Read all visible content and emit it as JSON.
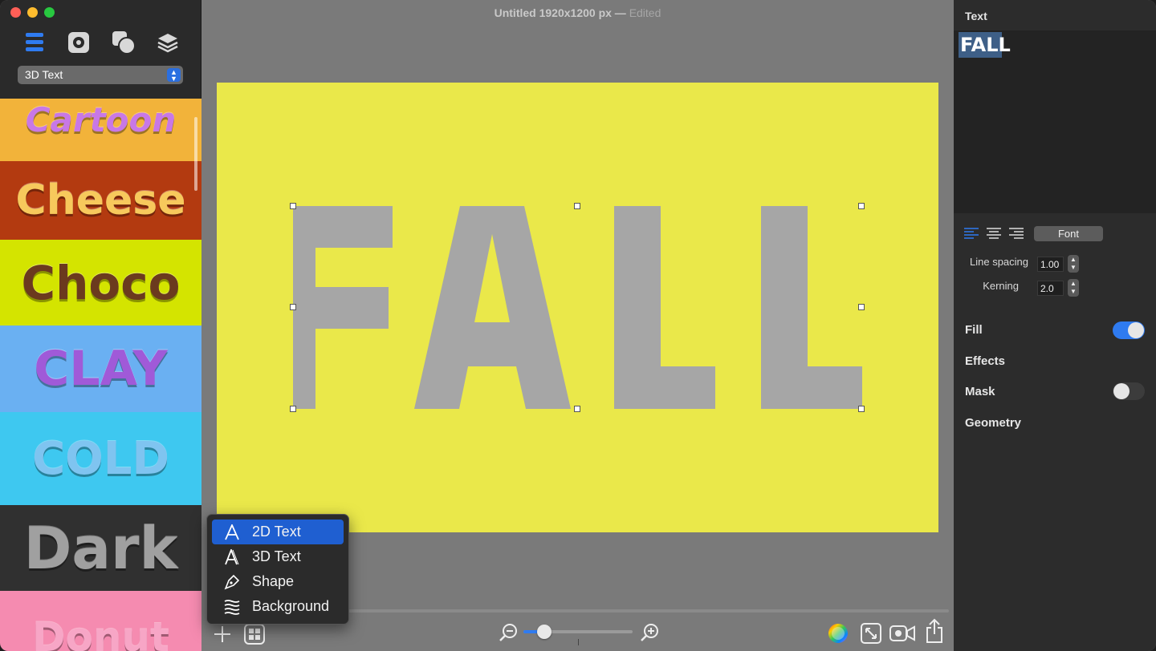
{
  "window": {
    "title": "Untitled 1920x1200 px",
    "title_sep": "—",
    "status": "Edited"
  },
  "sidebar": {
    "tool_icons": [
      "list-icon",
      "gear-icon",
      "shapes-icon",
      "layers-icon"
    ],
    "category_select": "3D Text",
    "presets": [
      {
        "label": "Cartoon",
        "bg": "#f2b33a",
        "color": "#c878e6"
      },
      {
        "label": "Cheese",
        "bg": "#b33a10",
        "color": "#f7c95c"
      },
      {
        "label": "Choco",
        "bg": "#d4e400",
        "color": "#6b3a1e"
      },
      {
        "label": "CLAY",
        "bg": "#6ab0f2",
        "color": "#a05ad8"
      },
      {
        "label": "COLD",
        "bg": "#3ec8f0",
        "color": "#7fc4f0"
      },
      {
        "label": "Dark",
        "bg": "#303030",
        "color": "#a0a0a0"
      },
      {
        "label": "Donut",
        "bg": "#f58bb0",
        "color": "#f7a6c6"
      }
    ]
  },
  "canvas": {
    "background": "#eae84a",
    "text": "FALL",
    "text_color": "#a6a6a6"
  },
  "add_menu": {
    "items": [
      {
        "label": "2D Text",
        "icon": "letter-a-icon",
        "selected": true
      },
      {
        "label": "3D Text",
        "icon": "letter-a-3d-icon",
        "selected": false
      },
      {
        "label": "Shape",
        "icon": "pen-icon",
        "selected": false
      },
      {
        "label": "Background",
        "icon": "background-icon",
        "selected": false
      }
    ]
  },
  "bottom_toolbar": {
    "add": "plus-icon",
    "gallery": "gallery-icon",
    "zoom_out": "zoom-out-icon",
    "zoom_in": "zoom-in-icon",
    "zoom_level": 0.19,
    "color": "color-wheel-icon",
    "resize": "resize-icon",
    "record": "video-icon",
    "share": "share-icon"
  },
  "inspector": {
    "title": "Text",
    "preview_text": "FALL",
    "font_button": "Font",
    "line_spacing_label": "Line spacing",
    "line_spacing_value": "1.00",
    "kerning_label": "Kerning",
    "kerning_value": "2.0",
    "sections": {
      "fill": "Fill",
      "effects": "Effects",
      "mask": "Mask",
      "geometry": "Geometry"
    },
    "fill_on": true,
    "mask_on": false,
    "accent": "#2f7bf0"
  }
}
